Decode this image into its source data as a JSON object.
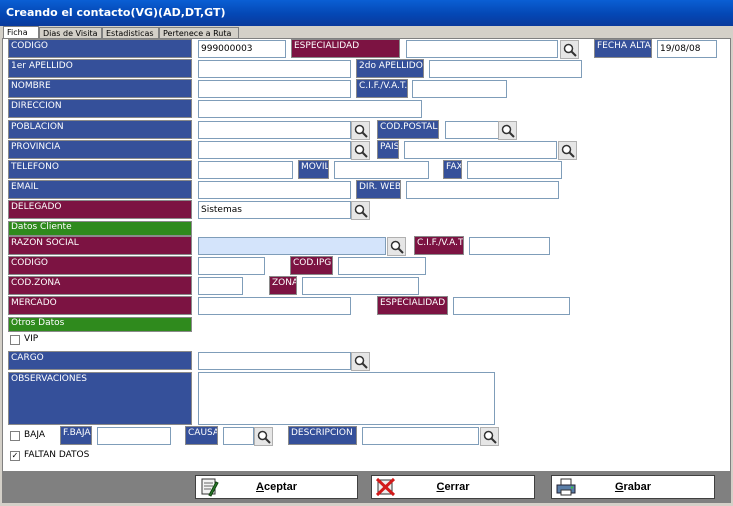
{
  "window": {
    "title": "Creando el contacto(VG)(AD,DT,GT)"
  },
  "tabs": [
    "Ficha",
    "Dias de Visita",
    "Estadisticas",
    "Pertenece a Ruta"
  ],
  "labels": {
    "codigo": "CODIGO",
    "especialidad": "ESPECIALIDAD",
    "fecha_alta": "FECHA ALTA",
    "apellido1": "1er APELLIDO",
    "apellido2": "2do APELLIDO",
    "nombre": "NOMBRE",
    "cif": "C.I.F./V.A.T.",
    "direccion": "DIRECCION",
    "poblacion": "POBLACION",
    "cod_postal": "COD.POSTAL",
    "provincia": "PROVINCIA",
    "pais": "PAIS",
    "telefono": "TELEFONO",
    "movil": "MOVIL",
    "fax": "FAX",
    "email": "EMAIL",
    "dir_web": "DIR. WEB",
    "delegado": "DELEGADO",
    "datos_cliente": "Datos Cliente",
    "razon_social": "RAZON SOCIAL",
    "cif2": "C.I.F./V.A.T.",
    "codigo2": "CODIGO",
    "cod_ipg": "COD.IPG",
    "cod_zona": "COD.ZONA",
    "zona": "ZONA",
    "mercado": "MERCADO",
    "especialidad2": "ESPECIALIDAD",
    "otros_datos": "Otros Datos",
    "cargo": "CARGO",
    "observaciones": "OBSERVACIONES",
    "f_baja": "F.BAJA",
    "causa": "CAUSA",
    "descripcion": "DESCRIPCION"
  },
  "values": {
    "codigo": "999000003",
    "fecha_alta": "19/08/08",
    "delegado": "Sistemas"
  },
  "checks": {
    "vip": {
      "label": "VIP",
      "checked": false
    },
    "baja": {
      "label": "BAJA",
      "checked": false
    },
    "faltan": {
      "label": "FALTAN DATOS",
      "checked": true
    }
  },
  "buttons": {
    "aceptar": "Aceptar",
    "cerrar": "Cerrar",
    "grabar": "Grabar"
  },
  "colors": {
    "label_blue": "#35509a",
    "label_red": "#7c1342",
    "section_green": "#2f8a1d",
    "highlight_field": "#d4e4fb"
  }
}
